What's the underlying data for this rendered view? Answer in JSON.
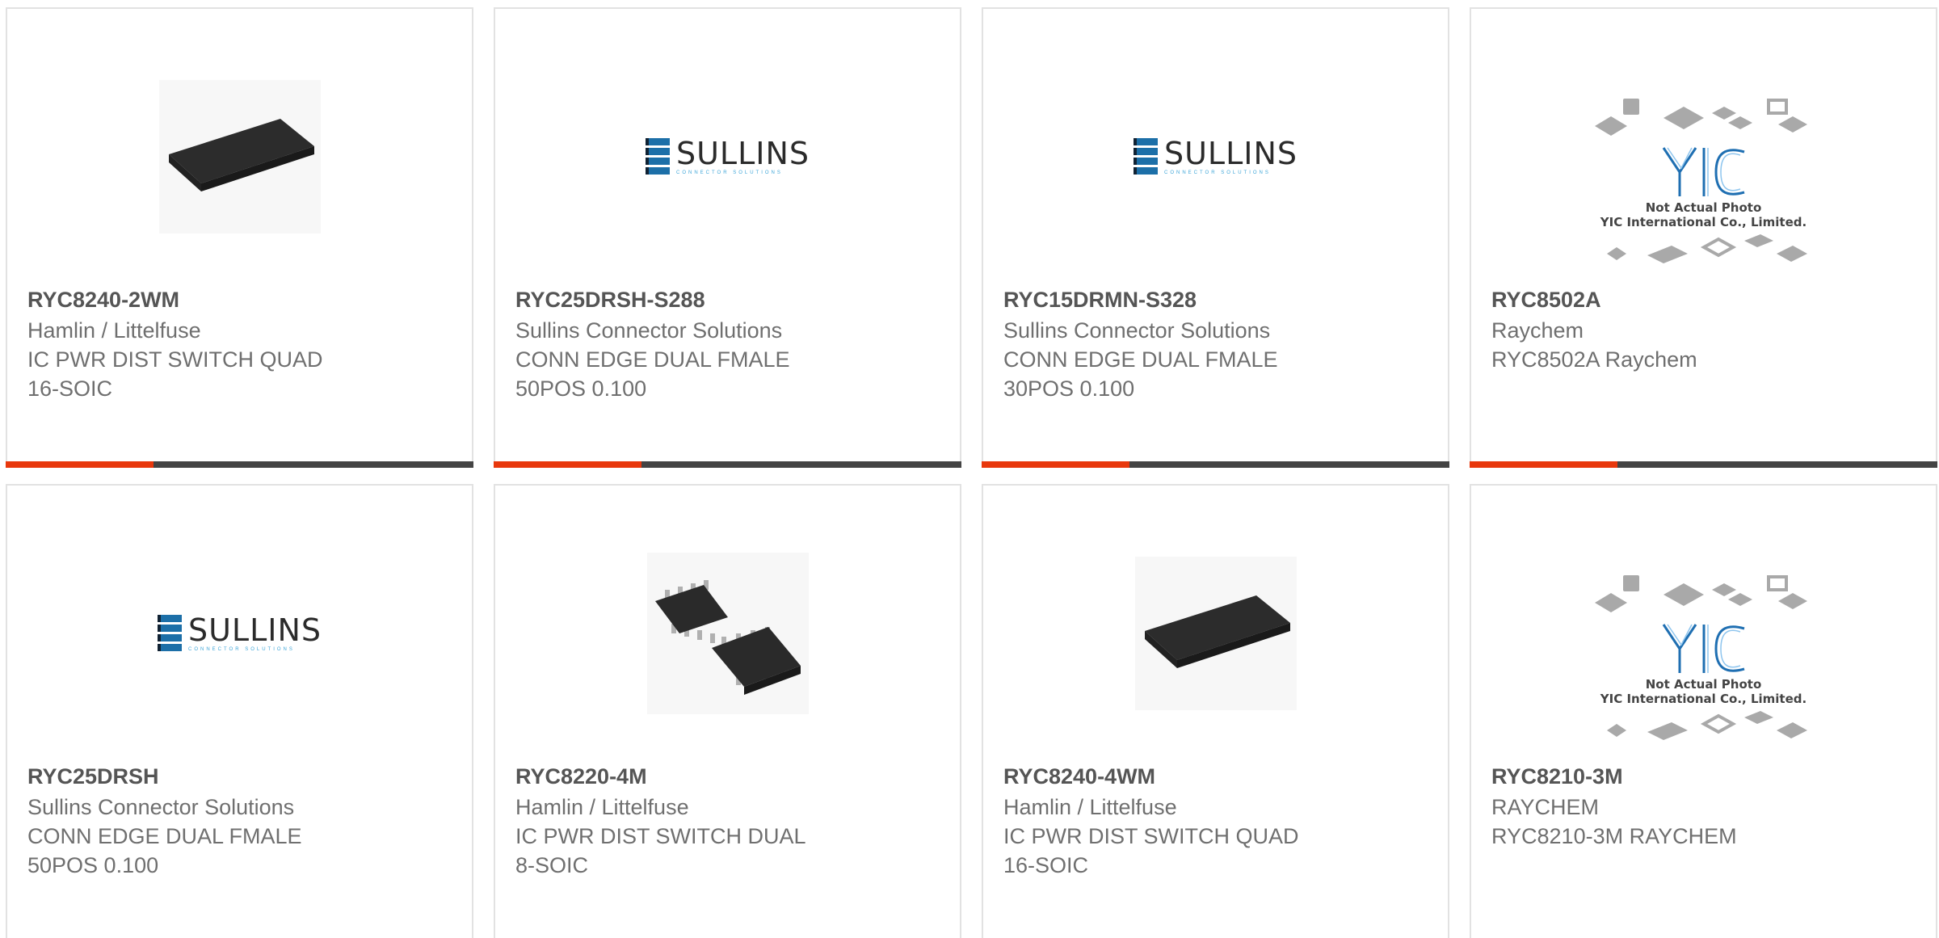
{
  "products": [
    {
      "part": "RYC8240-2WM",
      "manufacturer": "Hamlin / Littelfuse",
      "description": "IC PWR DIST SWITCH QUAD 16-SOIC",
      "image": "chip-soic16-icon"
    },
    {
      "part": "RYC25DRSH-S288",
      "manufacturer": "Sullins Connector Solutions",
      "description": "CONN EDGE DUAL FMALE 50POS 0.100",
      "image": "sullins-logo"
    },
    {
      "part": "RYC15DRMN-S328",
      "manufacturer": "Sullins Connector Solutions",
      "description": "CONN EDGE DUAL FMALE 30POS 0.100",
      "image": "sullins-logo"
    },
    {
      "part": "RYC8502A",
      "manufacturer": "Raychem",
      "description": "RYC8502A Raychem",
      "image": "yic-placeholder"
    },
    {
      "part": "RYC25DRSH",
      "manufacturer": "Sullins Connector Solutions",
      "description": "CONN EDGE DUAL FMALE 50POS 0.100",
      "image": "sullins-logo"
    },
    {
      "part": "RYC8220-4M",
      "manufacturer": "Hamlin / Littelfuse",
      "description": "IC PWR DIST SWITCH DUAL 8-SOIC",
      "image": "chip-soic8-icon"
    },
    {
      "part": "RYC8240-4WM",
      "manufacturer": "Hamlin / Littelfuse",
      "description": "IC PWR DIST SWITCH QUAD 16-SOIC",
      "image": "chip-soic16-icon"
    },
    {
      "part": "RYC8210-3M",
      "manufacturer": "RAYCHEM",
      "description": "RYC8210-3M RAYCHEM",
      "image": "yic-placeholder"
    }
  ],
  "sullins_logo": {
    "name": "SULLINS",
    "tagline": "CONNECTOR SOLUTIONS"
  },
  "yic_placeholder": {
    "line1": "Not Actual Photo",
    "line2": "YIC International Co., Limited."
  },
  "colors": {
    "accent": "#e8380d",
    "bar": "#444444",
    "border": "#e2e2e2",
    "text": "#6f6f6f"
  }
}
